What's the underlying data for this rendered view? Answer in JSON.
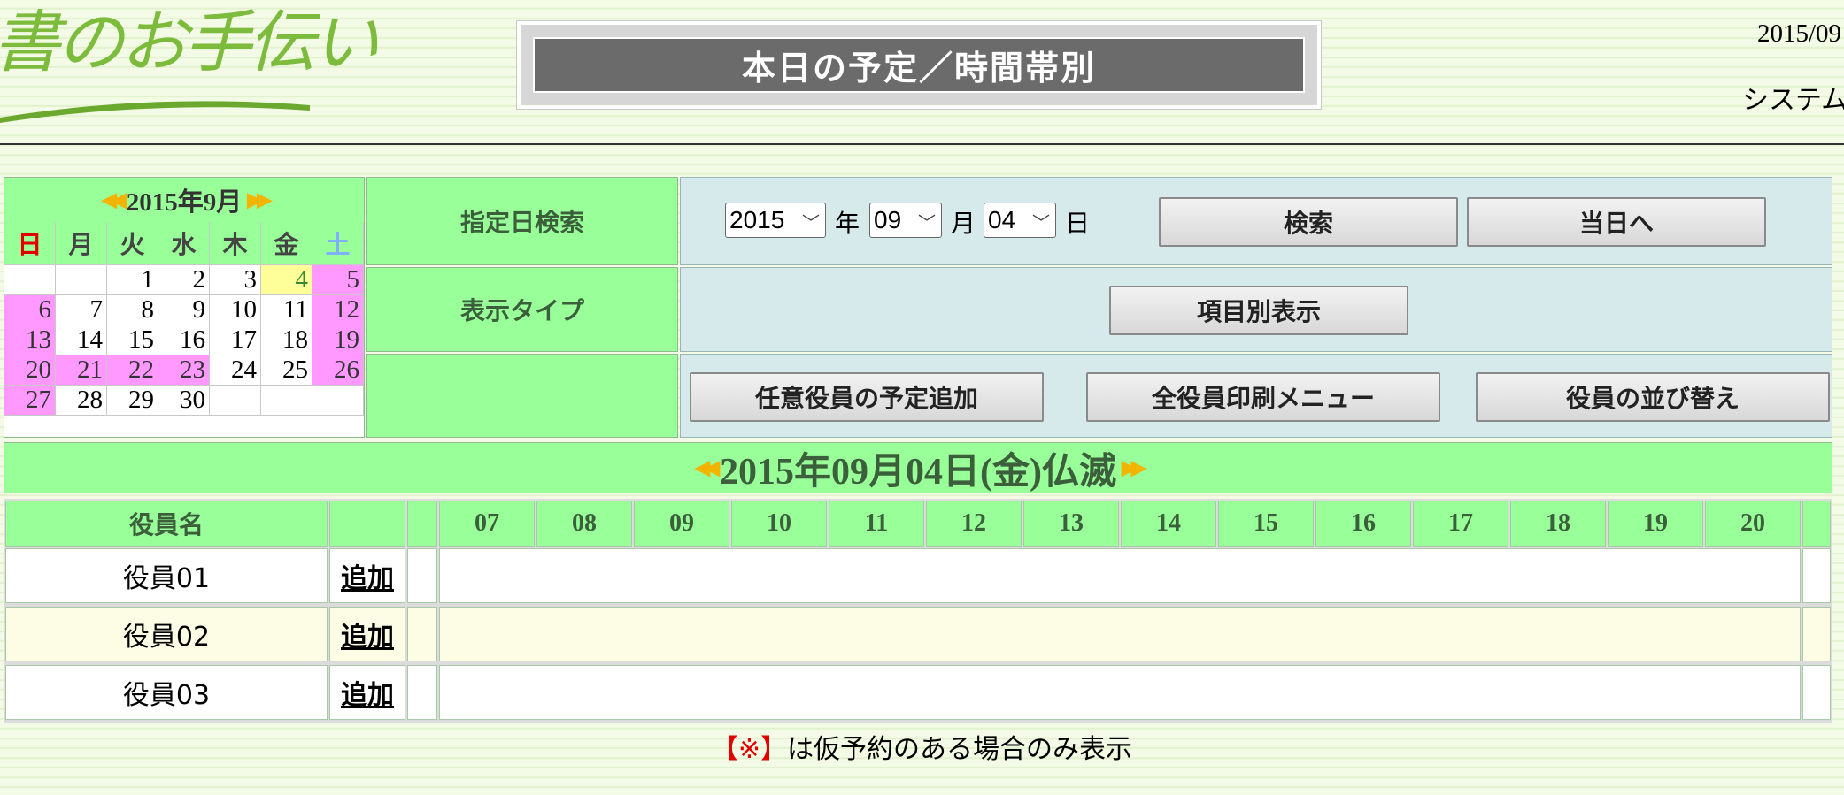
{
  "header": {
    "logo_text": "書のお手伝い",
    "title": "本日の予定／時間帯別",
    "date": "2015/09",
    "system": "システム"
  },
  "calendar": {
    "title": "2015年9月",
    "weekdays": [
      "日",
      "月",
      "火",
      "水",
      "木",
      "金",
      "土"
    ],
    "weeks": [
      [
        "",
        "",
        "1",
        "2",
        "3",
        "4",
        "5"
      ],
      [
        "6",
        "7",
        "8",
        "9",
        "10",
        "11",
        "12"
      ],
      [
        "13",
        "14",
        "15",
        "16",
        "17",
        "18",
        "19"
      ],
      [
        "20",
        "21",
        "22",
        "23",
        "24",
        "25",
        "26"
      ],
      [
        "27",
        "28",
        "29",
        "30",
        "",
        "",
        ""
      ]
    ]
  },
  "search": {
    "label": "指定日検索",
    "year": "2015",
    "year_unit": "年",
    "month": "09",
    "month_unit": "月",
    "day": "04",
    "day_unit": "日",
    "search_button": "検索",
    "today_button": "当日へ"
  },
  "display": {
    "label": "表示タイプ",
    "item_view_button": "項目別表示"
  },
  "actions": {
    "add_schedule": "任意役員の予定追加",
    "print_menu": "全役員印刷メニュー",
    "reorder": "役員の並び替え"
  },
  "day_banner": "2015年09月04日(金)仏滅",
  "schedule": {
    "name_header": "役員名",
    "hours": [
      "07",
      "08",
      "09",
      "10",
      "11",
      "12",
      "13",
      "14",
      "15",
      "16",
      "17",
      "18",
      "19",
      "20"
    ],
    "rows": [
      {
        "name": "役員01",
        "add": "追加"
      },
      {
        "name": "役員02",
        "add": "追加"
      },
      {
        "name": "役員03",
        "add": "追加"
      }
    ]
  },
  "note": {
    "mark": "【※】",
    "text": "は仮予約のある場合のみ表示"
  }
}
